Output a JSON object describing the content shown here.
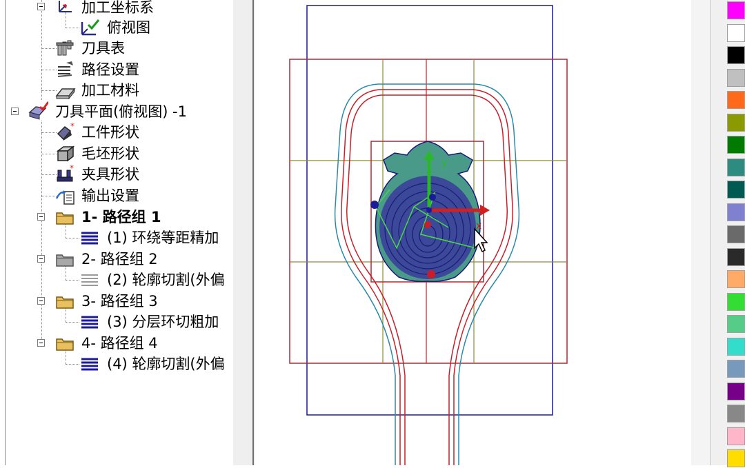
{
  "tree": {
    "items": [
      {
        "label": "加工坐标系",
        "icon": "coordinate-system-icon"
      },
      {
        "label": "俯视图",
        "icon": "top-view-icon"
      },
      {
        "label": "刀具表",
        "icon": "tool-table-icon"
      },
      {
        "label": "路径设置",
        "icon": "path-settings-icon"
      },
      {
        "label": "加工材料",
        "icon": "material-icon"
      },
      {
        "label": "刀具平面(俯视图) -1",
        "icon": "tool-plane-icon"
      },
      {
        "label": "工件形状",
        "icon": "workpiece-shape-icon"
      },
      {
        "label": "毛坯形状",
        "icon": "stock-shape-icon"
      },
      {
        "label": "夹具形状",
        "icon": "fixture-shape-icon"
      },
      {
        "label": "输出设置",
        "icon": "output-settings-icon"
      },
      {
        "label": "1- 路径组 1",
        "icon": "folder-icon"
      },
      {
        "label": "(1) 环绕等距精加",
        "icon": "toolpath-icon"
      },
      {
        "label": "2- 路径组 2",
        "icon": "folder-gray-icon"
      },
      {
        "label": "(2) 轮廓切割(外偏",
        "icon": "toolpath-disabled-icon"
      },
      {
        "label": "3- 路径组 3",
        "icon": "folder-icon"
      },
      {
        "label": "(3) 分层环切粗加",
        "icon": "toolpath-icon"
      },
      {
        "label": "4- 路径组 4",
        "icon": "folder-icon"
      },
      {
        "label": "(4) 轮廓切割(外偏",
        "icon": "toolpath-icon"
      }
    ]
  },
  "viewport": {
    "name": "toolpath-viewport"
  },
  "palette": {
    "colors": [
      "#ff00ff",
      "#ffffff",
      "#000000",
      "#c0c0c0",
      "#ff6a1a",
      "#8b9a00",
      "#007a00",
      "#2e8b7f",
      "#005a52",
      "#8080d0",
      "#6a6a6a",
      "#2a2a2a",
      "#ffaa66",
      "#33dd33",
      "#55cc88",
      "#33ddcc",
      "#7799bb",
      "#770088",
      "#888888",
      "#ffb6c8",
      "#ffdd00"
    ]
  }
}
